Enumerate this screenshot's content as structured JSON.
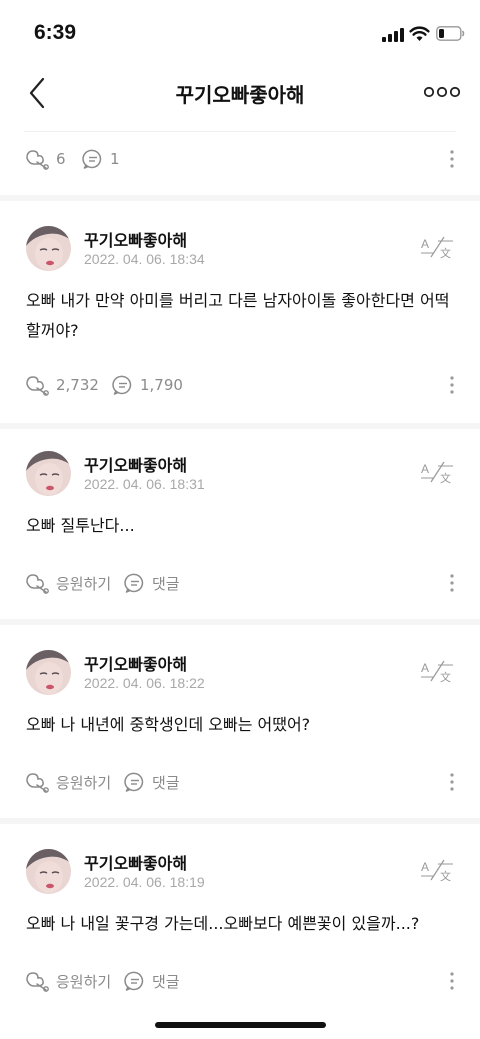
{
  "status": {
    "time": "6:39"
  },
  "nav": {
    "title": "꾸기오빠좋아해"
  },
  "top_actions": {
    "cheer_count": "6",
    "comment_count": "1"
  },
  "posts": [
    {
      "author": "꾸기오빠좋아해",
      "date": "2022. 04. 06. 18:34",
      "text": "오빠 내가 만약 아미를 버리고 다른 남자아이돌 좋아한다면 어떡할꺼야?",
      "cheer": "2,732",
      "comment": "1,790"
    },
    {
      "author": "꾸기오빠좋아해",
      "date": "2022. 04. 06. 18:31",
      "text": "오빠 질투난다...",
      "cheer": "응원하기",
      "comment": "댓글"
    },
    {
      "author": "꾸기오빠좋아해",
      "date": "2022. 04. 06. 18:22",
      "text": "오빠 나 내년에 중학생인데 오빠는 어땠어?",
      "cheer": "응원하기",
      "comment": "댓글"
    },
    {
      "author": "꾸기오빠좋아해",
      "date": "2022. 04. 06. 18:19",
      "text": "오빠 나 내일 꽃구경 가는데...오빠보다 예쁜꽃이 있을까...?",
      "cheer": "응원하기",
      "comment": "댓글"
    }
  ],
  "colors": {
    "muted": "#8b8b8b",
    "date": "#a8a8a8",
    "divider": "#f5f5f5"
  },
  "icons": [
    "back-chevron-icon",
    "more-icon",
    "cheer-icon",
    "comment-icon",
    "vertical-dots-icon",
    "translate-icon"
  ]
}
